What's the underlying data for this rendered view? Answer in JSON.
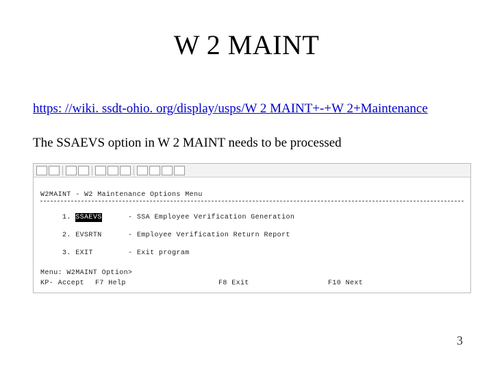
{
  "slide": {
    "title": "W 2 MAINT",
    "link_text": "https: //wiki. ssdt-ohio. org/display/usps/W 2 MAINT+-+W 2+Maintenance",
    "body_text": "The SSAEVS option in W 2 MAINT needs to be processed",
    "page_number": "3"
  },
  "terminal": {
    "header": "W2MAINT - W2 Maintenance Options Menu",
    "options": [
      {
        "num": "1.",
        "code": "SSAEVS",
        "desc": "- SSA Employee Verification Generation",
        "highlight": true
      },
      {
        "num": "2.",
        "code": "EVSRTN",
        "desc": "- Employee Verification Return Report",
        "highlight": false
      },
      {
        "num": "3.",
        "code": "EXIT",
        "desc": "- Exit program",
        "highlight": false
      }
    ],
    "menu_prompt": "Menu: W2MAINT Option>",
    "fkeys": {
      "kp": "KP-   Accept",
      "f7": "F7   Help",
      "f8": "F8   Exit",
      "f10": "F10  Next"
    }
  }
}
